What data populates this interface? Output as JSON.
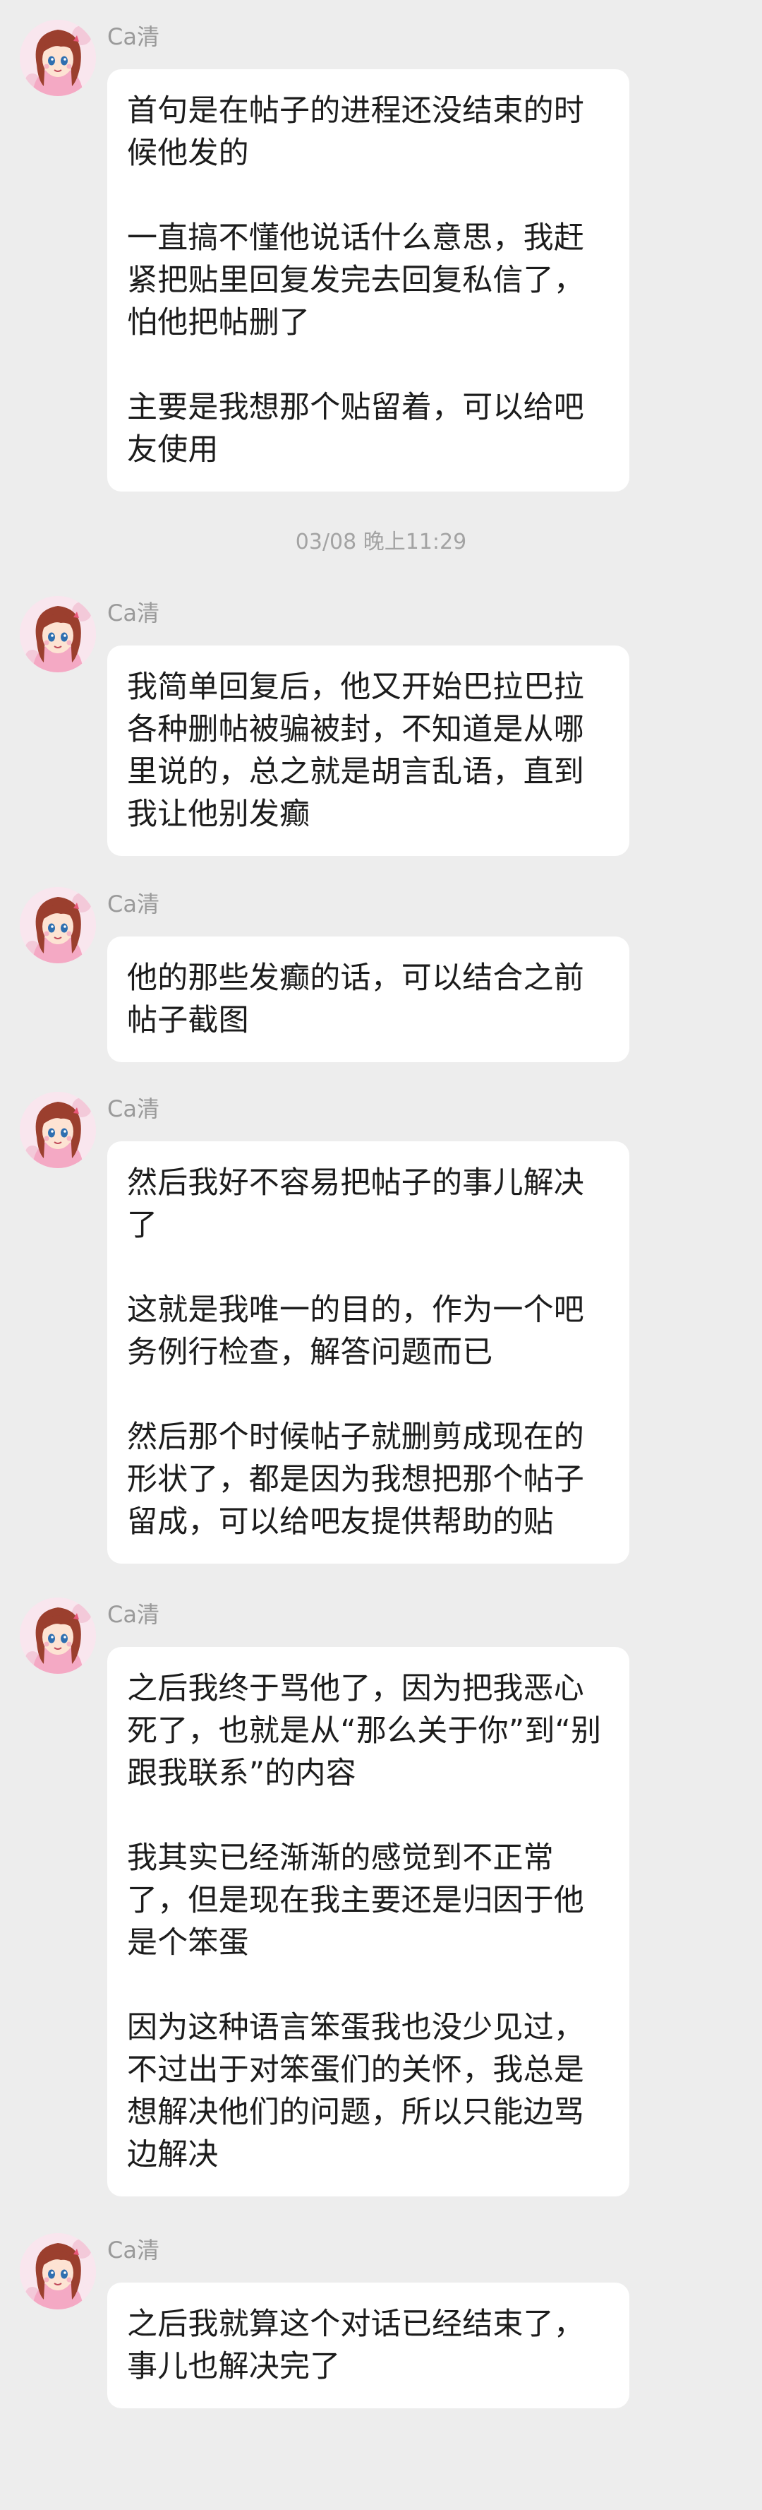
{
  "sender_name": "Ca清",
  "timestamp": "03/08 晚上11:29",
  "messages": [
    {
      "paragraphs": [
        "首句是在帖子的进程还没结束的时候他发的",
        "一直搞不懂他说话什么意思，我赶紧把贴里回复发完去回复私信了，怕他把帖删了",
        "主要是我想那个贴留着，可以给吧友使用"
      ]
    },
    {
      "paragraphs": [
        "我简单回复后，他又开始巴拉巴拉各种删帖被骗被封，不知道是从哪里说的，总之就是胡言乱语，直到我让他别发癫"
      ]
    },
    {
      "paragraphs": [
        "他的那些发癫的话，可以结合之前帖子截图"
      ]
    },
    {
      "paragraphs": [
        "然后我好不容易把帖子的事儿解决了",
        "这就是我唯一的目的，作为一个吧务例行检查，解答问题而已",
        "然后那个时候帖子就删剪成现在的形状了，都是因为我想把那个帖子留成，可以给吧友提供帮助的贴"
      ]
    },
    {
      "paragraphs": [
        "之后我终于骂他了，因为把我恶心死了，也就是从“那么关于你”到“别跟我联系”的内容",
        "我其实已经渐渐的感觉到不正常了，但是现在我主要还是归因于他是个笨蛋",
        "因为这种语言笨蛋我也没少见过，不过出于对笨蛋们的关怀，我总是想解决他们的问题，所以只能边骂边解决"
      ]
    },
    {
      "paragraphs": [
        "之后我就算这个对话已经结束了，事儿也解决完了"
      ]
    }
  ]
}
